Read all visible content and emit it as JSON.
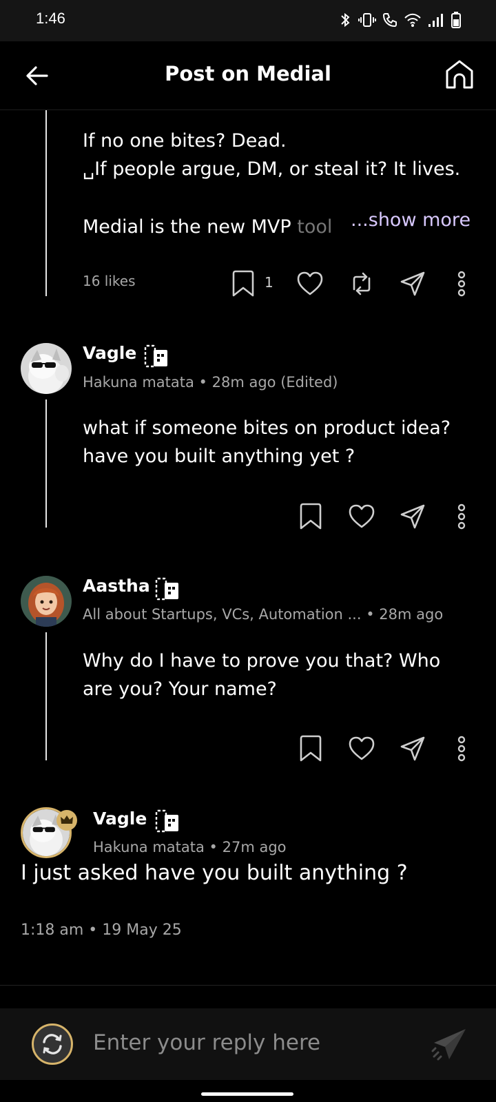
{
  "status_bar": {
    "time": "1:46"
  },
  "header": {
    "title": "Post on Medial"
  },
  "post": {
    "line1": "If no one bites? Dead.",
    "line2": "␣If people argue, DM, or steal it? It lives.",
    "line3_main": "Medial is the new MVP ",
    "line3_fade": "tool",
    "show_more": "...show more",
    "likes": "16 likes",
    "comment_count": "1"
  },
  "comments": [
    {
      "name": "Vagle",
      "headline": "Hakuna matata",
      "time": "28m ago (Edited)",
      "text_line1": "what if someone bites on product idea?",
      "text_line2": "have you built anything yet ?"
    },
    {
      "name": "Aastha",
      "headline": "All about Startups, VCs, Automation ...",
      "time": "28m ago",
      "text_line1": "Why do I have to prove you that? Who",
      "text_line2": "are you? Your name?"
    }
  ],
  "focused_reply": {
    "name": "Vagle",
    "headline": "Hakuna matata",
    "time": "27m ago",
    "text": "I just asked have you built anything ?",
    "timestamp": "1:18 am • 19 May 25"
  },
  "reply_bar": {
    "placeholder": "Enter your reply here"
  },
  "colors": {
    "accent_gold": "#d7b46a",
    "show_more": "#d9c9ff"
  },
  "icons": [
    "back-arrow-icon",
    "home-icon",
    "bookmark-icon",
    "heart-icon",
    "repost-icon",
    "send-icon",
    "more-vertical-icon",
    "crown-icon",
    "refresh-icon",
    "paper-plane-icon"
  ]
}
